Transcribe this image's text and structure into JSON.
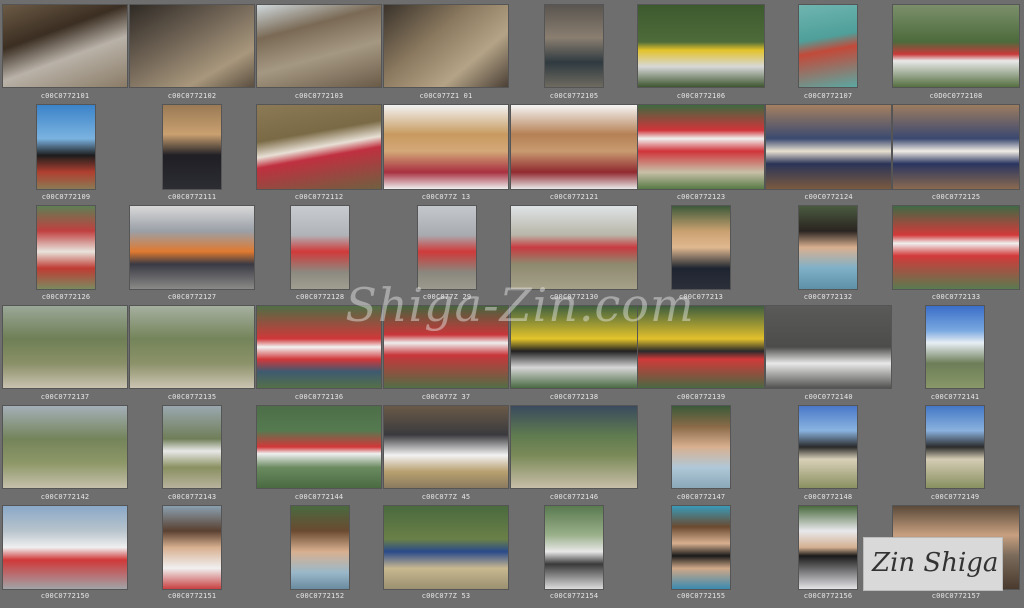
{
  "watermark": "Shiga-Zin.com",
  "captions": {
    "r1": [
      "c00C0772101",
      "c00C0772102",
      "c00C0772103",
      "c00C077Z1 01",
      "c00C0772105",
      "c00C0772106",
      "c00C0772107",
      "c0D0C0772108"
    ],
    "r2": [
      "c00C0772109",
      "c00C0772111",
      "c00C0772112",
      "c00C077Z 13",
      "c00C0772121",
      "c00C0772123",
      "c00C0772124",
      "c00C0772125"
    ],
    "r3": [
      "c00C0772126",
      "c00C0772127",
      "c00C0772128",
      "c00C077Z 29",
      "c00C0772130",
      "c00C077213",
      "c00C0772132",
      "c00C0772133"
    ],
    "r4": [
      "c00C0772137",
      "c00C0772135",
      "c00C0772136",
      "c00C077Z 37",
      "c00C0772138",
      "c00C0772139",
      "c00C0772140",
      "c00C0772141"
    ],
    "r5": [
      "c00C0772142",
      "c00C0772143",
      "c00C0772144",
      "c00C077Z 45",
      "c00C0772146",
      "c00C0772147",
      "c00C0772148",
      "c00C0772149"
    ],
    "r6": [
      "c00C0772150",
      "c00C0772151",
      "c00C0772152",
      "c00C077Z 53",
      "c00C0772154",
      "c00C0772155",
      "c00C0772156",
      "c00C0772157"
    ]
  }
}
